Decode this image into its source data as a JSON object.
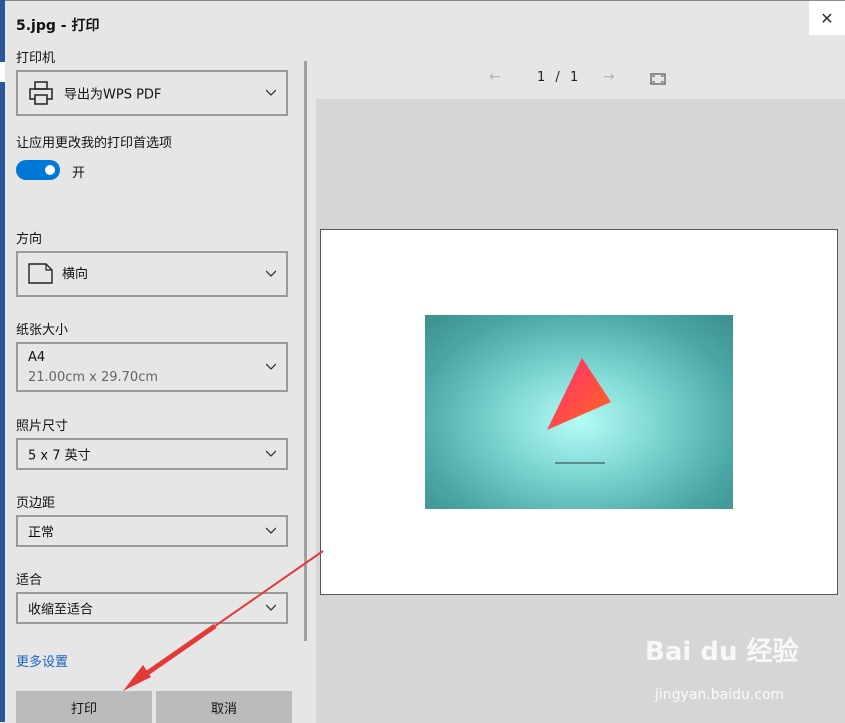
{
  "window": {
    "title": "5.jpg - 打印",
    "close_glyph": "✕"
  },
  "printer": {
    "label": "打印机",
    "value": "导出为WPS PDF",
    "icon": "printer-icon"
  },
  "app_prefs": {
    "label": "让应用更改我的打印首选项",
    "toggle_state": "开",
    "toggle_on": true,
    "accent_color": "#0078d7"
  },
  "orientation": {
    "label": "方向",
    "value": "横向",
    "icon": "page-landscape-icon"
  },
  "paper_size": {
    "label": "纸张大小",
    "value": "A4",
    "detail": "21.00cm x 29.70cm"
  },
  "photo_size": {
    "label": "照片尺寸",
    "value": "5 x 7 英寸"
  },
  "margins": {
    "label": "页边距",
    "value": "正常"
  },
  "fit": {
    "label": "适合",
    "value": "收缩至适合"
  },
  "more_settings": "更多设置",
  "buttons": {
    "print": "打印",
    "cancel": "取消"
  },
  "preview": {
    "page_current": "1",
    "page_separator": "/",
    "page_total": "1",
    "prev_glyph": "←",
    "next_glyph": "→"
  },
  "watermark": {
    "brand": "Bai du 经验",
    "url": "jingyan.baidu.com"
  }
}
